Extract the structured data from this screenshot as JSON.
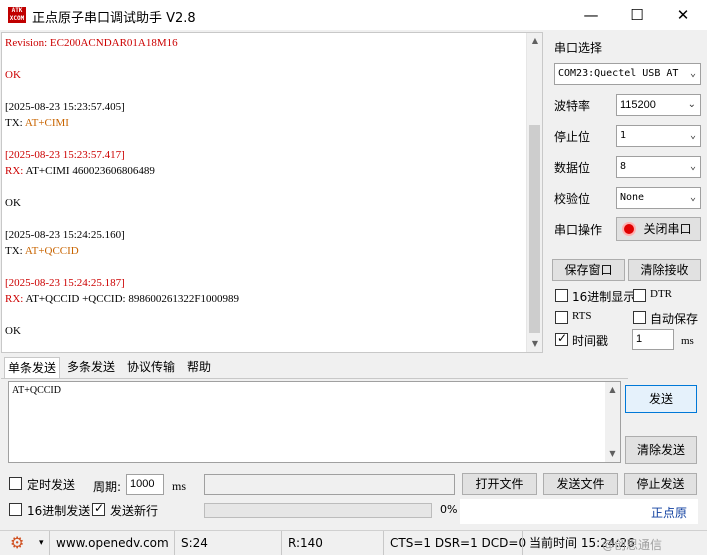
{
  "window": {
    "logo_text": "ATK\nXCOM",
    "title": "正点原子串口调试助手 V2.8",
    "minimize_glyph": "—",
    "maximize_glyph": "☐",
    "close_glyph": "✕"
  },
  "receive": {
    "lines": [
      {
        "text": "Revision: EC200ACNDAR01A18M16",
        "color": "red"
      },
      {
        "text": "",
        "color": ""
      },
      {
        "text": "OK",
        "color": "red"
      },
      {
        "text": "",
        "color": ""
      },
      {
        "text": "[2025-08-23 15:23:57.405]",
        "color": ""
      },
      {
        "text": "TX: ",
        "tail": "AT+CIMI",
        "color": "",
        "tailcolor": "orange"
      },
      {
        "text": "",
        "color": ""
      },
      {
        "text": "[2025-08-23 15:23:57.417]",
        "color": "red"
      },
      {
        "text": "RX: ",
        "tail": "AT+CIMI 460023606806489",
        "color": "red",
        "tailcolor": ""
      },
      {
        "text": "",
        "color": ""
      },
      {
        "text": "OK",
        "color": ""
      },
      {
        "text": "",
        "color": ""
      },
      {
        "text": "[2025-08-23 15:24:25.160]",
        "color": ""
      },
      {
        "text": "TX: ",
        "tail": "AT+QCCID",
        "color": "",
        "tailcolor": "orange"
      },
      {
        "text": "",
        "color": ""
      },
      {
        "text": "[2025-08-23 15:24:25.187]",
        "color": "red"
      },
      {
        "text": "RX: ",
        "tail": "AT+QCCID +QCCID: 898600261322F1000989",
        "color": "red",
        "tailcolor": ""
      },
      {
        "text": "",
        "color": ""
      },
      {
        "text": "OK",
        "color": ""
      }
    ]
  },
  "settings": {
    "port_label": "串口选择",
    "port_value": "COM23:Quectel USB AT",
    "baud_label": "波特率",
    "baud_value": "115200",
    "stop_label": "停止位",
    "stop_value": "1",
    "data_label": "数据位",
    "data_value": "8",
    "parity_label": "校验位",
    "parity_value": "None",
    "op_label": "串口操作",
    "op_button": "关闭串口",
    "save_window": "保存窗口",
    "clear_receive": "清除接收",
    "hex_display": "16进制显示",
    "dtr": "DTR",
    "rts": "RTS",
    "auto_save": "自动保存",
    "timestamp": "时间戳",
    "timestamp_value": "1",
    "timestamp_unit": "ms"
  },
  "tabs": [
    "单条发送",
    "多条发送",
    "协议传输",
    "帮助"
  ],
  "send": {
    "text": "AT+QCCID",
    "send_button": "发送",
    "clear_send": "清除发送",
    "timed_send": "定时发送",
    "period_label": "周期:",
    "period_value": "1000",
    "period_unit": "ms",
    "open_file": "打开文件",
    "send_file": "发送文件",
    "stop_send": "停止发送",
    "hex_send": "16进制发送",
    "newline": "发送新行",
    "progress": "0%",
    "brand": "正点原"
  },
  "status": {
    "url": "www.openedv.com",
    "s": "S:24",
    "r": "R:140",
    "lines": "CTS=1 DSR=1 DCD=0",
    "time": "当前时间 15:24:26",
    "watermark": "@创思通信"
  }
}
